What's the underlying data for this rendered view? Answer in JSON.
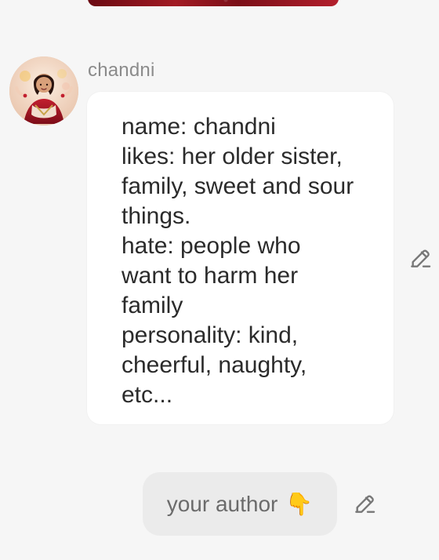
{
  "chat": {
    "sender": {
      "name": "chandni",
      "avatar_icon": "profile-photo"
    },
    "messages": [
      {
        "type": "character-intro",
        "lines": [
          "name: chandni",
          "likes: her older sister,",
          "family, sweet and sour",
          "things.",
          "hate: people who",
          "want to harm her",
          "family",
          "personality: kind,",
          "cheerful, naughty,",
          "etc..."
        ],
        "edit_icon": "pencil-icon"
      },
      {
        "type": "outgoing",
        "text": "your author",
        "emoji": "👇",
        "edit_icon": "pencil-icon"
      }
    ]
  },
  "colors": {
    "background": "#f6f6f6",
    "bubble": "#ffffff",
    "pill": "#ebebeb",
    "name_text": "#8b8b8b",
    "message_text": "#2b2b2b",
    "pill_text": "#6b6b6b",
    "media_strip": "#8e1620"
  }
}
